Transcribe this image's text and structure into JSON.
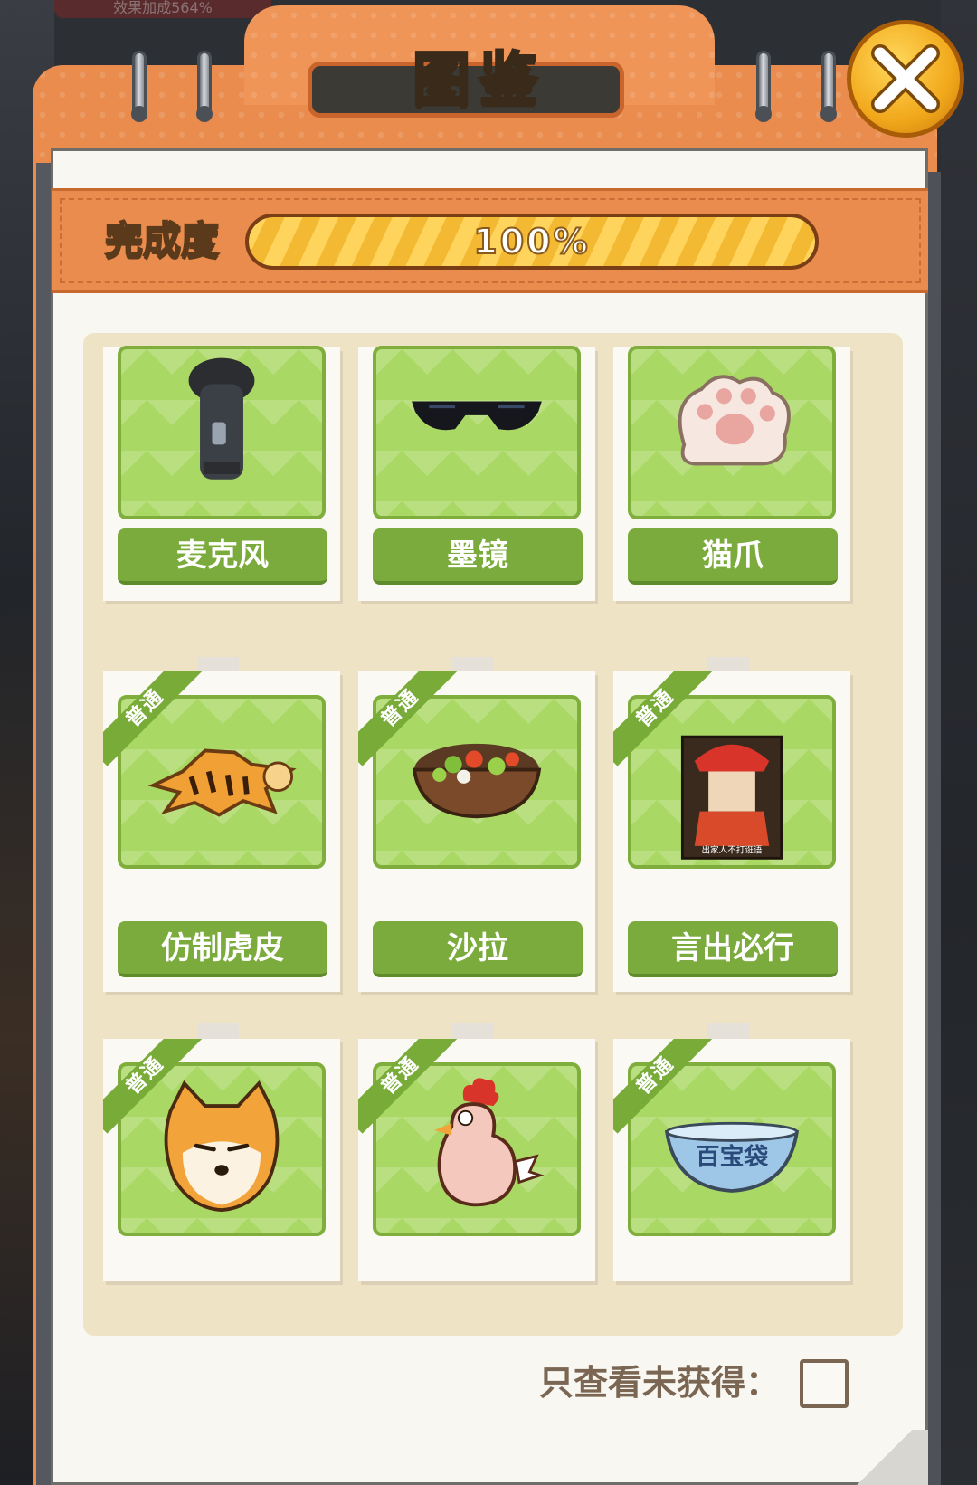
{
  "background": {
    "top_banner": "效果加成564%"
  },
  "header": {
    "title": "图鉴",
    "close_icon": "close-icon"
  },
  "progress": {
    "label": "完成度",
    "value_text": "100%",
    "fraction": 1.0
  },
  "grid": {
    "rows": [
      {
        "items": [
          {
            "name": "麦克风",
            "badge": "",
            "icon": "microphone-icon"
          },
          {
            "name": "墨镜",
            "badge": "",
            "icon": "sunglasses-icon"
          },
          {
            "name": "猫爪",
            "badge": "",
            "icon": "cat-paw-icon"
          }
        ]
      },
      {
        "items": [
          {
            "name": "仿制虎皮",
            "badge": "普通",
            "icon": "tiger-skin-icon"
          },
          {
            "name": "沙拉",
            "badge": "普通",
            "icon": "salad-icon"
          },
          {
            "name": "言出必行",
            "badge": "普通",
            "icon": "monk-poster-icon",
            "poster_caption": "出家人不打诳语"
          }
        ]
      },
      {
        "items": [
          {
            "name": "",
            "badge": "普通",
            "icon": "shiba-face-icon"
          },
          {
            "name": "",
            "badge": "普通",
            "icon": "rooster-icon"
          },
          {
            "name": "",
            "badge": "普通",
            "icon": "treasure-bowl-icon",
            "bowl_text": "百宝袋"
          }
        ]
      }
    ]
  },
  "filter": {
    "label": "只查看未获得：",
    "checked": false
  },
  "colors": {
    "accent_orange": "#e98c4e",
    "card_green": "#a9d864",
    "button_green": "#7bab3c",
    "gold": "#f2a81b"
  }
}
